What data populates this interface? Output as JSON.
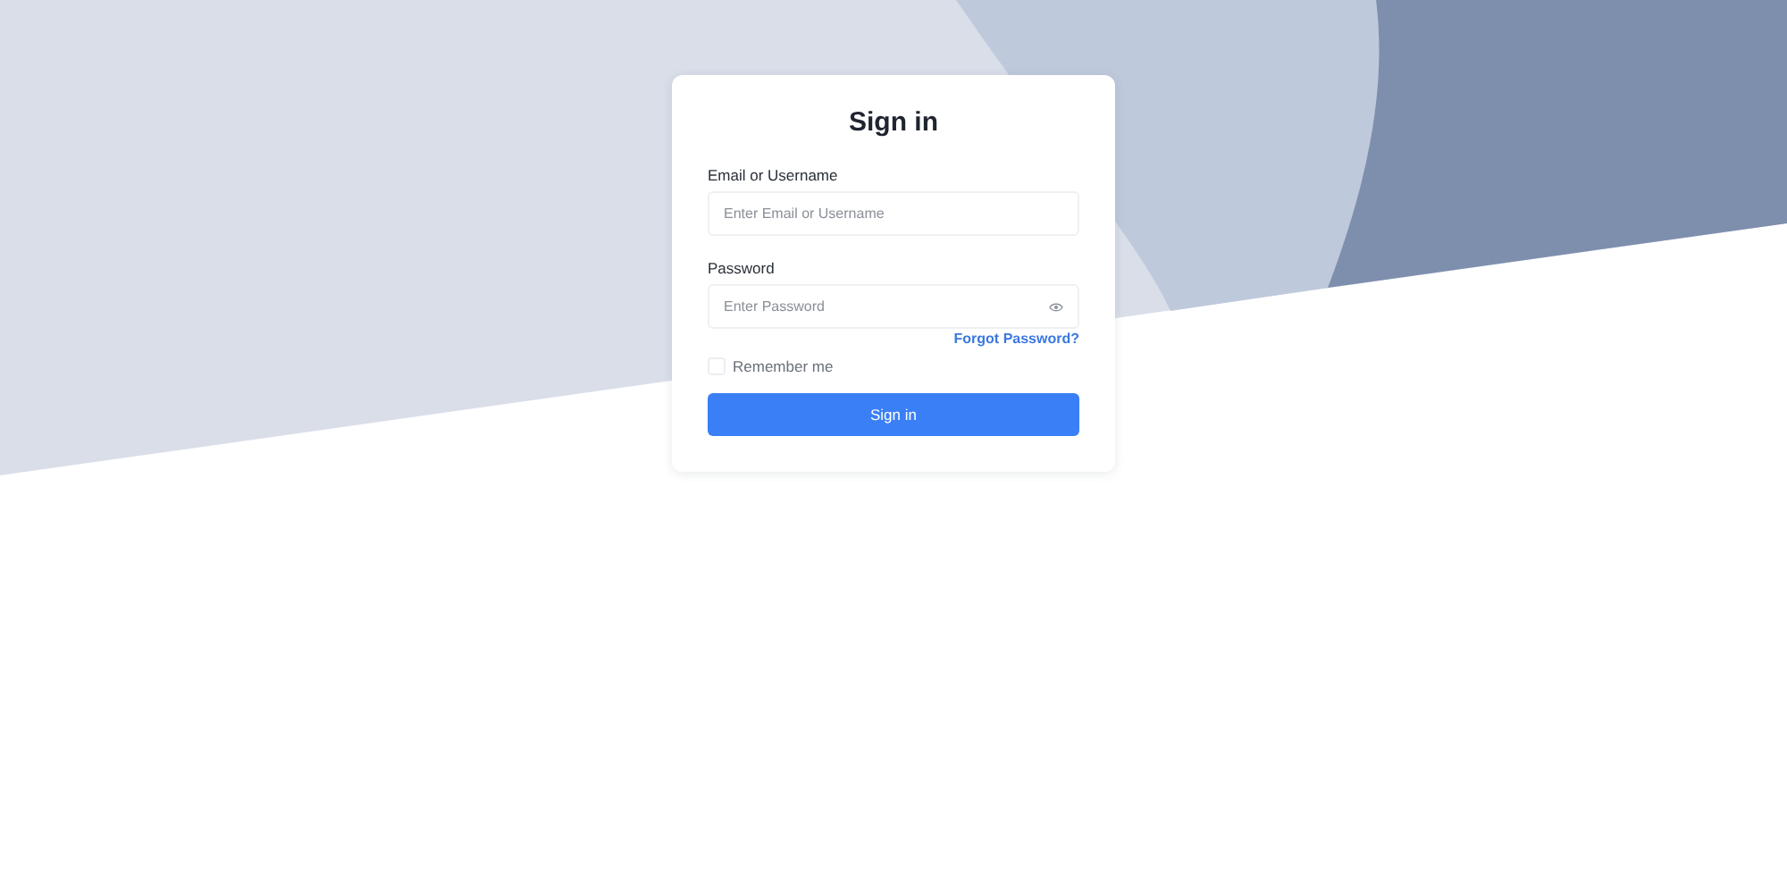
{
  "form": {
    "title": "Sign in",
    "fields": [
      {
        "label": "Email or Username",
        "placeholder": "Enter Email or Username",
        "kind": "text"
      },
      {
        "label": "Password",
        "placeholder": "Enter Password",
        "kind": "password"
      }
    ],
    "forgot_link": "Forgot Password?",
    "remember": {
      "label": "Remember me",
      "checked": false
    },
    "submit": "Sign in"
  }
}
